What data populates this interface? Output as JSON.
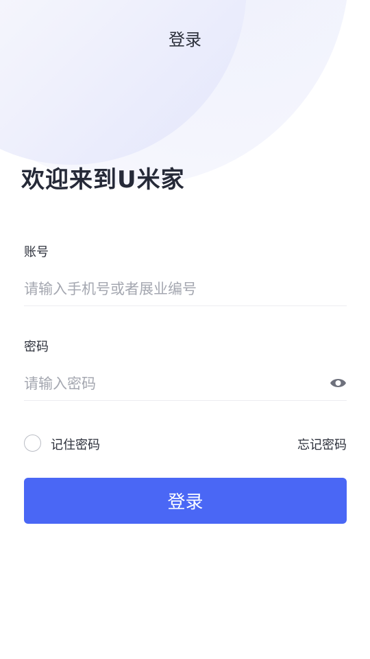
{
  "header": {
    "title": "登录"
  },
  "welcome": {
    "text": "欢迎来到U米家"
  },
  "account": {
    "label": "账号",
    "placeholder": "请输入手机号或者展业编号",
    "value": ""
  },
  "password": {
    "label": "密码",
    "placeholder": "请输入密码",
    "value": "",
    "toggle_icon": "eye-icon"
  },
  "remember": {
    "label": "记住密码",
    "checked": false
  },
  "forgot": {
    "label": "忘记密码"
  },
  "submit": {
    "label": "登录"
  },
  "colors": {
    "accent": "#4a67f5",
    "text": "#2b2f3a",
    "placeholder": "#a4a7b0"
  }
}
